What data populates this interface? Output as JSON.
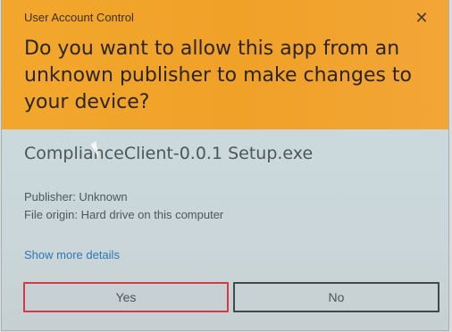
{
  "dialog": {
    "title": "User Account Control",
    "close_icon": "close-icon",
    "question": "Do you want to allow this app from an unknown publisher to make changes to your device?",
    "app_name": "ComplianceClient-0.0.1 Setup.exe",
    "publisher_text": "Publisher: Unknown",
    "file_origin_text": "File origin: Hard drive on this computer",
    "details_link": "Show more details",
    "buttons": {
      "yes": "Yes",
      "no": "No"
    },
    "colors": {
      "header": "#f0a128",
      "body": "#cbd9dd",
      "link": "#2c79b3",
      "focus_border": "#d33a48"
    }
  }
}
